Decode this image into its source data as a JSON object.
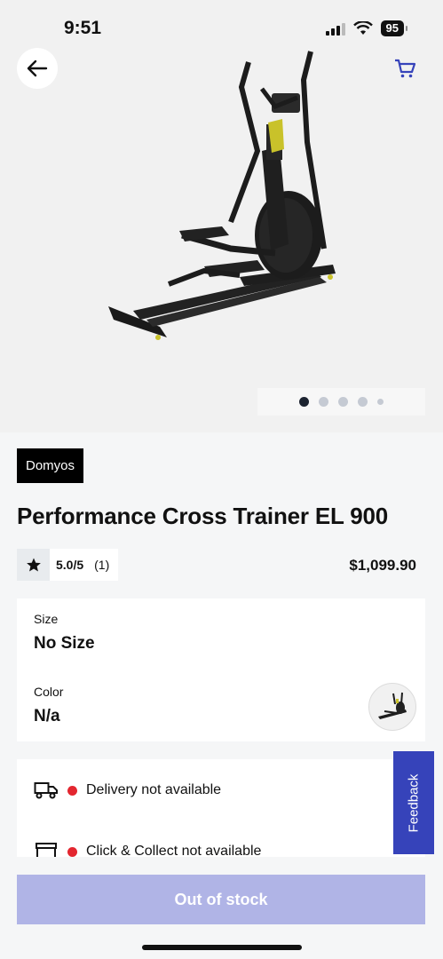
{
  "status_bar": {
    "time": "9:51",
    "battery": "95"
  },
  "hero": {
    "image_count": 5,
    "active_image": 0
  },
  "product": {
    "brand": "Domyos",
    "title": "Performance Cross Trainer EL 900",
    "rating": "5.0/5",
    "review_count": "(1)",
    "price": "$1,099.90"
  },
  "options": {
    "size_label": "Size",
    "size_value": "No Size",
    "color_label": "Color",
    "color_value": "N/a"
  },
  "delivery": {
    "home": "Delivery not available",
    "click_collect": "Click & Collect not available"
  },
  "feedback_label": "Feedback",
  "cta_label": "Out of stock",
  "colors": {
    "accent": "#3643ba",
    "cta_disabled": "#b0b4e6",
    "unavailable": "#e3262f"
  }
}
